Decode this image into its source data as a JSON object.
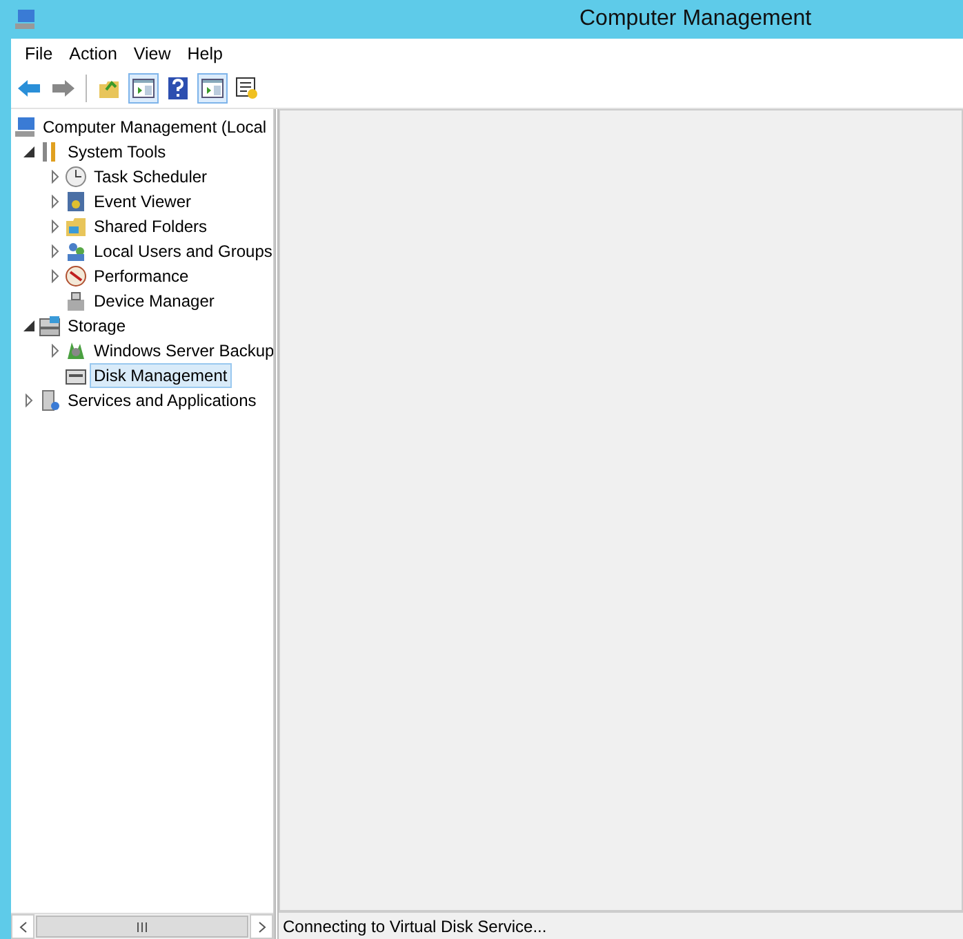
{
  "window": {
    "title": "Computer Management"
  },
  "menu": [
    "File",
    "Action",
    "View",
    "Help"
  ],
  "nav": [
    {
      "kind": "back",
      "disabled": false
    },
    {
      "kind": "forward",
      "disabled": true
    }
  ],
  "toolbar": [
    {
      "kind": "up"
    },
    {
      "kind": "pane"
    },
    {
      "kind": "help"
    },
    {
      "kind": "pane"
    },
    {
      "kind": "props"
    }
  ],
  "tree": [
    {
      "label": "Computer Management (Local",
      "kind": "root",
      "selected": false,
      "children": [
        {
          "label": "System Tools",
          "kind": "branch",
          "expanded": true,
          "selected": false,
          "children": [
            {
              "label": "Task Scheduler",
              "kind": "branch",
              "expanded": false,
              "selected": false
            },
            {
              "label": "Event Viewer",
              "kind": "branch",
              "expanded": false,
              "selected": false
            },
            {
              "label": "Shared Folders",
              "kind": "branch",
              "expanded": false,
              "selected": false
            },
            {
              "label": "Local Users and Groups",
              "kind": "branch",
              "expanded": false,
              "selected": false
            },
            {
              "label": "Performance",
              "kind": "branch",
              "expanded": false,
              "selected": false
            },
            {
              "label": "Device Manager",
              "kind": "leaf",
              "selected": false
            }
          ]
        },
        {
          "label": "Storage",
          "kind": "branch",
          "expanded": true,
          "selected": false,
          "children": [
            {
              "label": "Windows Server Backup",
              "kind": "branch",
              "expanded": false,
              "selected": false
            },
            {
              "label": "Disk Management",
              "kind": "leaf",
              "selected": true
            }
          ]
        },
        {
          "label": "Services and Applications",
          "kind": "branch",
          "expanded": false,
          "selected": false
        }
      ]
    }
  ],
  "status_bar": "Connecting to Virtual Disk Service..."
}
